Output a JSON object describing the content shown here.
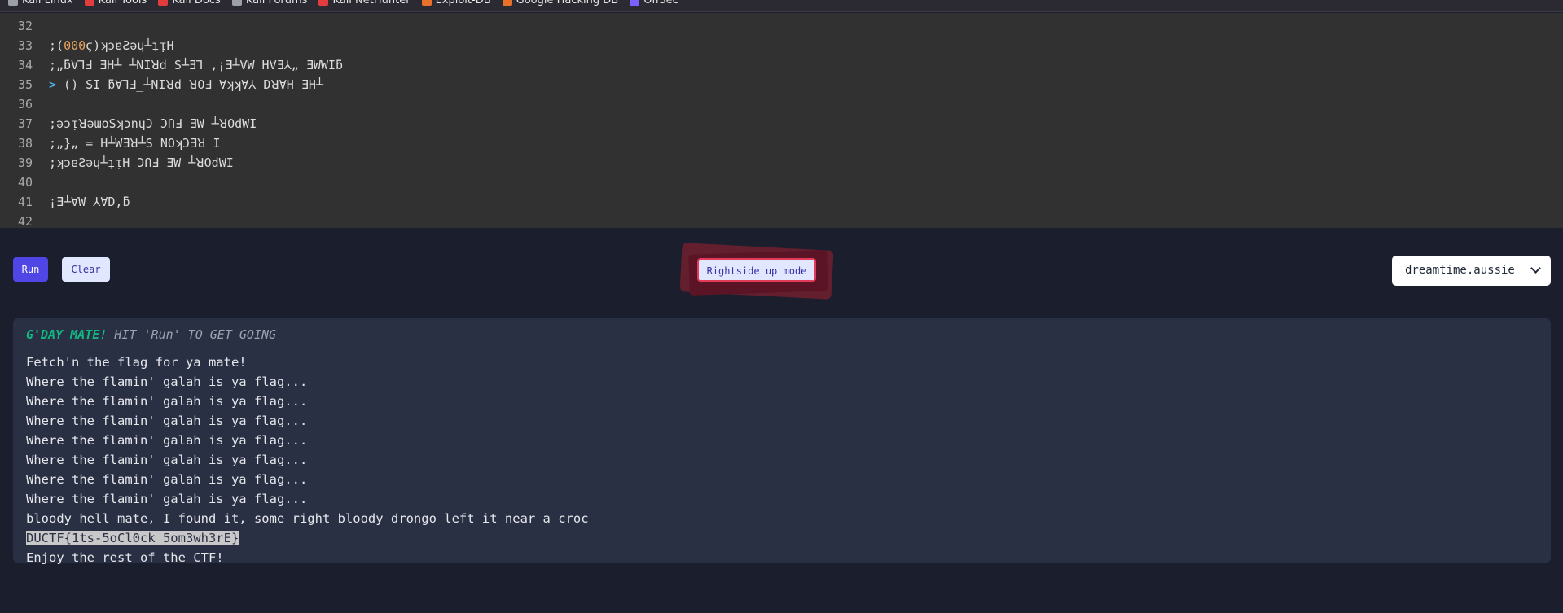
{
  "bookmarks": [
    {
      "label": "Kali Linux",
      "icon": "kali-dragon-icon",
      "color": "#9aa0a6"
    },
    {
      "label": "Kali Tools",
      "icon": "kali-tools-icon",
      "color": "#e23c3c"
    },
    {
      "label": "Kali Docs",
      "icon": "kali-docs-icon",
      "color": "#e23c3c"
    },
    {
      "label": "Kali Forums",
      "icon": "kali-forums-icon",
      "color": "#9aa0a6"
    },
    {
      "label": "Kali NetHunter",
      "icon": "kali-nethunter-icon",
      "color": "#e23c3c"
    },
    {
      "label": "Exploit-DB",
      "icon": "exploit-db-icon",
      "color": "#e8702a"
    },
    {
      "label": "Google Hacking DB",
      "icon": "ghdb-icon",
      "color": "#e8702a"
    },
    {
      "label": "OffSec",
      "icon": "offsec-icon",
      "color": "#7b61ff"
    }
  ],
  "editor": {
    "lines": [
      {
        "num": "32",
        "code": ""
      },
      {
        "num": "33",
        "pre": ";(",
        "num_token": "000",
        "post": "ϛ)ʞɔɐƧǝɥ┴ʇᴉH"
      },
      {
        "num": "34",
        "pre": ";„ƃ∀ꞀℲ ƎH┴ ┴NIꓤd S┴ƎꞀ ,¡Ǝ┴∀W H∀Ǝ⅄„ ƎWWIƃ",
        "num_token": "",
        "post": ""
      },
      {
        "num": "35",
        "arrow": ">",
        "pre": " () SI ƃ∀ꞀℲ_┴NIꓤd ꓤOℲ ∀ʞʞ∀⅄ Dꓤ∀H ƎH┴",
        "num_token": "",
        "post": ""
      },
      {
        "num": "36",
        "code": ""
      },
      {
        "num": "37",
        "pre": ";ǝɔᴉꓤǝɯoSʞɔnɥƆ ƆՈℲ ƎW ┴ꓤOdWI",
        "num_token": "",
        "post": ""
      },
      {
        "num": "38",
        "pre": ";„}„ = H┴WƎꓤ┴S NOʞƆƎꓤ I",
        "num_token": "",
        "post": ""
      },
      {
        "num": "39",
        "pre": ";ʞɔɐƧǝɥ┴ʇᴉH ƆՈℲ ƎW ┴ꓤOdWI",
        "num_token": "",
        "post": ""
      },
      {
        "num": "40",
        "code": ""
      },
      {
        "num": "41",
        "pre": "¡Ǝ┴∀W ⅄∀D,ƃ",
        "num_token": "",
        "post": ""
      },
      {
        "num": "42",
        "code": ""
      }
    ]
  },
  "controls": {
    "run_label": "Run",
    "clear_label": "Clear",
    "rightside_label": "Rightside up mode",
    "select_value": "dreamtime.aussie"
  },
  "output": {
    "header_brand": "G'DAY MATE!",
    "header_rest": " HIT 'Run' TO GET GOING",
    "lines": [
      "Fetch'n the flag for ya mate!",
      "Where the flamin' galah is ya flag...",
      "Where the flamin' galah is ya flag...",
      "Where the flamin' galah is ya flag...",
      "Where the flamin' galah is ya flag...",
      "Where the flamin' galah is ya flag...",
      "Where the flamin' galah is ya flag...",
      "Where the flamin' galah is ya flag...",
      "bloody hell mate, I found it, some right bloody drongo left it near a croc"
    ],
    "flag": "DUCTF{1ts-5oCl0ck_5om3wh3rE}",
    "footer_line": "Enjoy the rest of the CTF!"
  },
  "colors": {
    "accent": "#4f46e5",
    "brand_green": "#10b981",
    "highlight_red": "#e23c5a"
  }
}
